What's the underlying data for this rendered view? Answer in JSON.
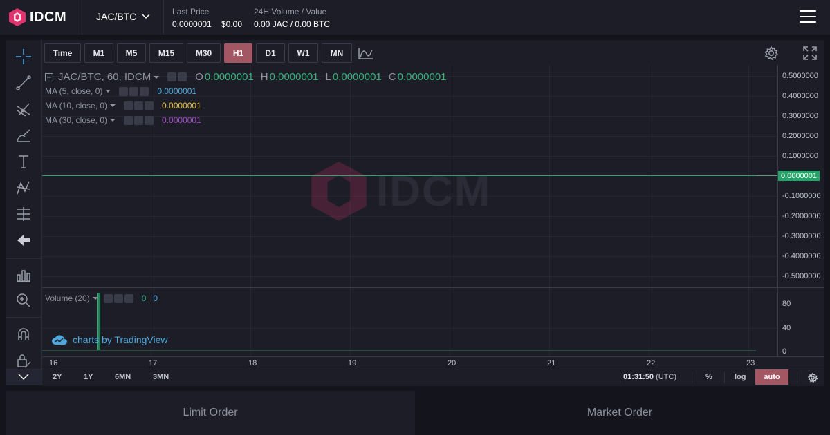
{
  "header": {
    "brand": "IDCM",
    "pair": "JAC/BTC",
    "last_price_label": "Last Price",
    "last_price_btc": "0.0000001",
    "last_price_usd": "$0.00",
    "volume_label": "24H Volume / Value",
    "volume_value": "0.00 JAC / 0.00 BTC",
    "menu_icon": "hamburger-menu-icon"
  },
  "chart": {
    "timeframes": [
      "Time",
      "M1",
      "M5",
      "M15",
      "M30",
      "H1",
      "D1",
      "W1",
      "MN"
    ],
    "active_timeframe": "H1",
    "legend": {
      "title": "JAC/BTC, 60, IDCM",
      "o_key": "O",
      "o_val": "0.0000001",
      "h_key": "H",
      "h_val": "0.0000001",
      "l_key": "L",
      "l_val": "0.0000001",
      "c_key": "C",
      "c_val": "0.0000001"
    },
    "indicators": [
      {
        "label": "MA (5, close, 0)",
        "value": "0.0000001",
        "color": "#4ea8de"
      },
      {
        "label": "MA (10, close, 0)",
        "value": "0.0000001",
        "color": "#e8c43a"
      },
      {
        "label": "MA (30, close, 0)",
        "value": "0.0000001",
        "color": "#a64ec9"
      }
    ],
    "volume_legend": {
      "label": "Volume (20)",
      "v1": "0",
      "v2": "0"
    },
    "price_axis": [
      "0.5000000",
      "0.4000000",
      "0.3000000",
      "0.2000000",
      "0.1000000",
      "-0.1000000",
      "-0.2000000",
      "-0.3000000",
      "-0.4000000",
      "-0.5000000"
    ],
    "last_price_tag": "0.0000001",
    "volume_axis": [
      "80",
      "40",
      "0"
    ],
    "time_axis": [
      "16",
      "17",
      "18",
      "19",
      "20",
      "21",
      "22",
      "23"
    ],
    "ranges": [
      "2Y",
      "1Y",
      "6MN",
      "3MN"
    ],
    "clock_time": "01:31:50",
    "clock_tz": "(UTC)",
    "percent_label": "%",
    "log_label": "log",
    "auto_label": "auto",
    "watermark": "IDCM",
    "credit": "charts by TradingView",
    "up_color": "#34b27a",
    "accent_color": "#a25763"
  },
  "orders": {
    "tabs": [
      "Limit Order",
      "Market Order"
    ]
  }
}
